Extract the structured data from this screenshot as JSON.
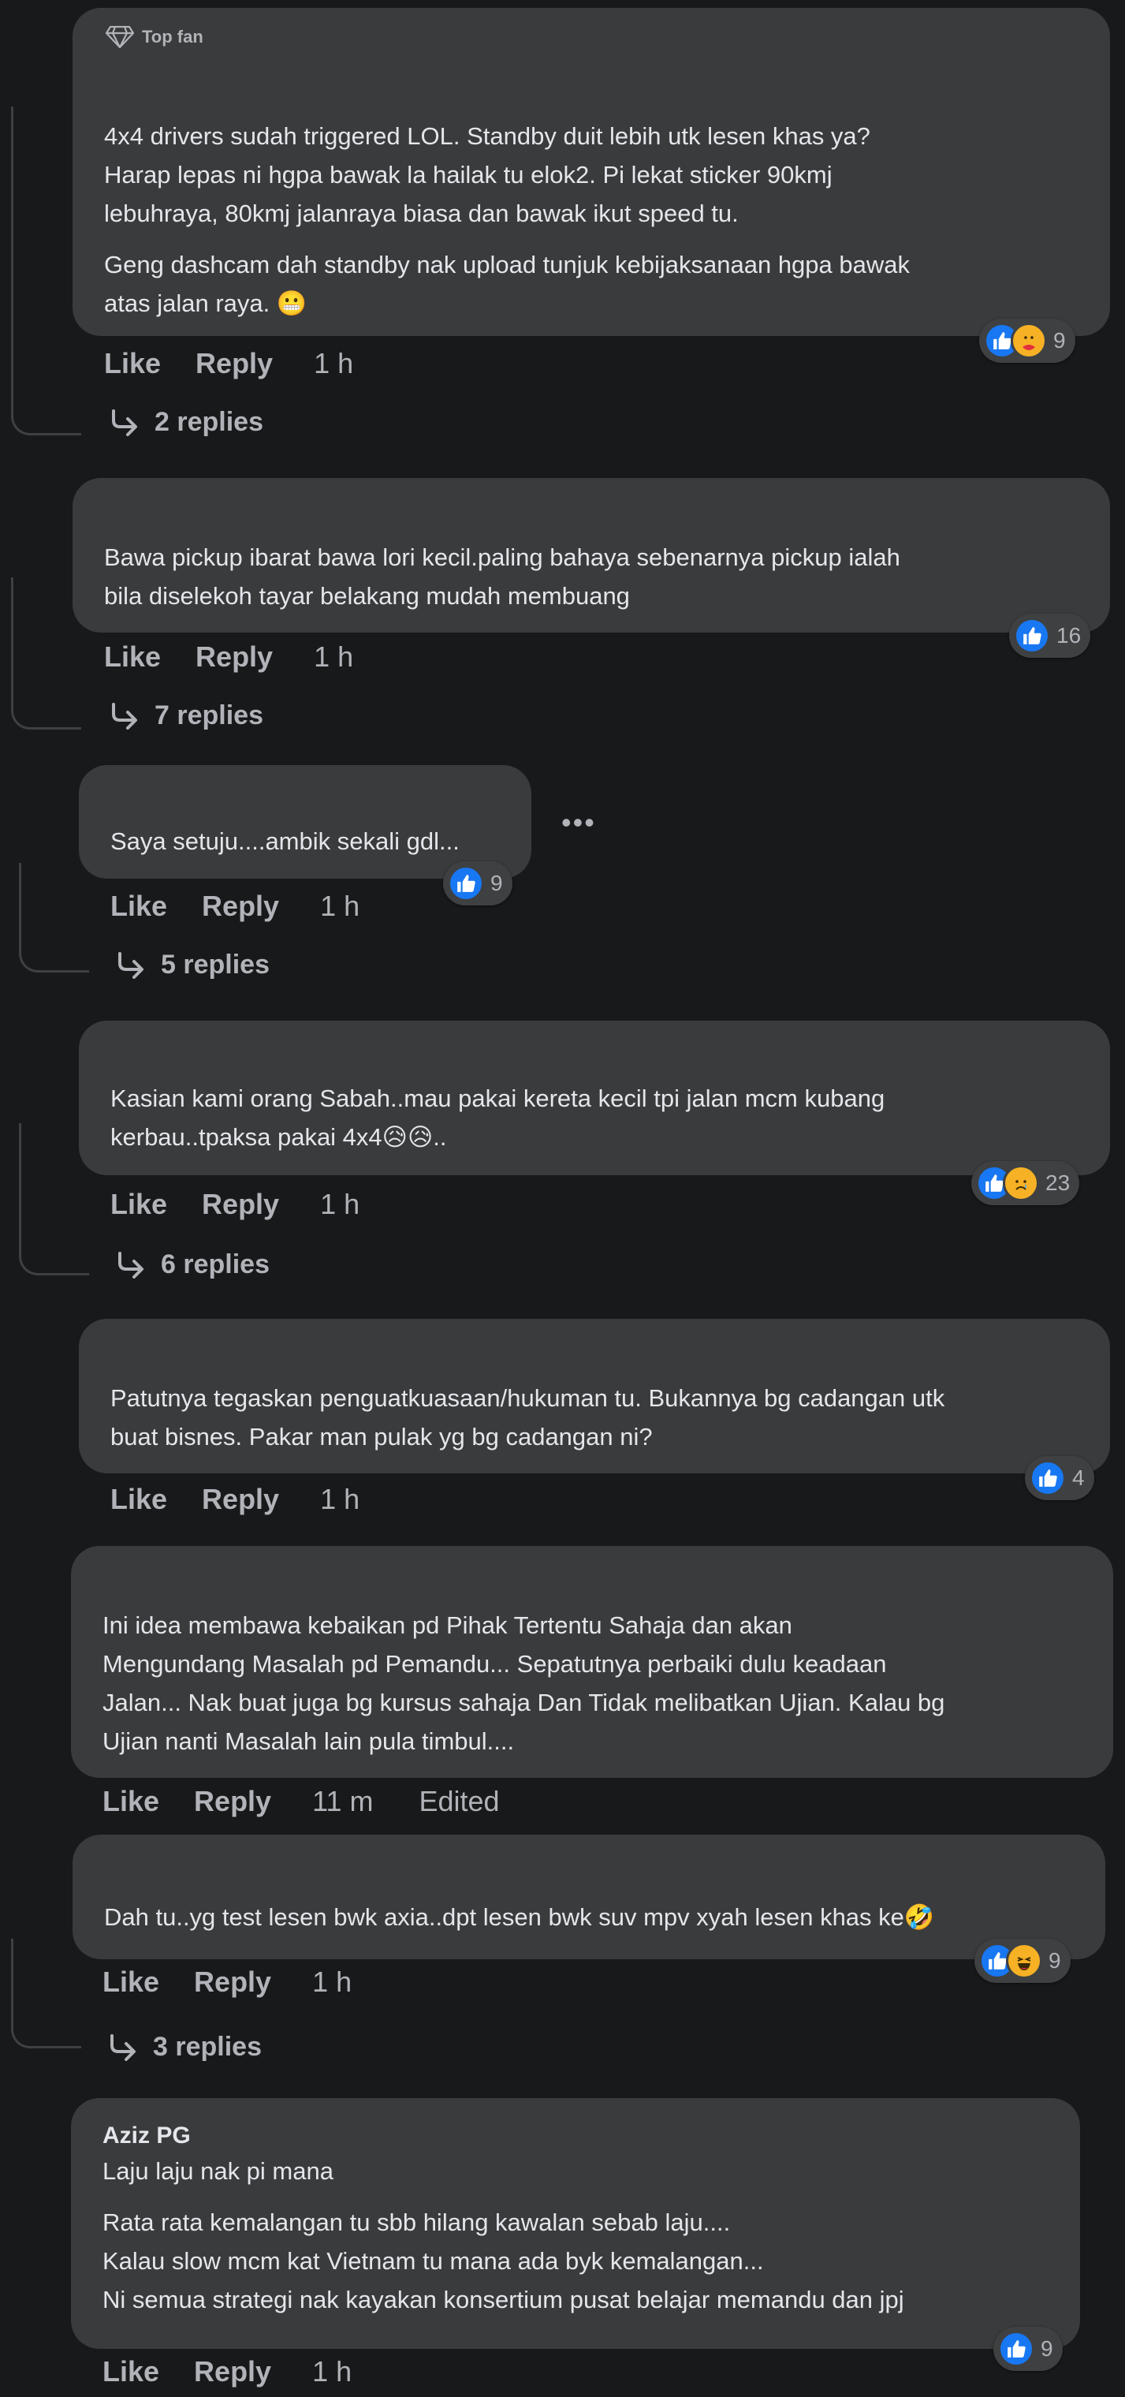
{
  "comments": [
    {
      "badge": "Top fan",
      "paragraphs": [
        "4x4 drivers sudah triggered LOL. Standby duit lebih utk lesen khas ya?\nHarap lepas ni hgpa bawak la hailak tu elok2. Pi lekat sticker 90kmj\nlebuhraya, 80kmj jalanraya biasa dan bawak ikut speed tu.",
        "Geng dashcam dah standby nak upload tunjuk kebijaksanaan hgpa bawak\natas jalan raya. 😬"
      ],
      "reaction_count": "9",
      "like": "Like",
      "reply": "Reply",
      "time": "1 h",
      "replies": "2 replies"
    },
    {
      "paragraphs": [
        "Bawa pickup ibarat bawa lori kecil.paling bahaya sebenarnya pickup ialah\nbila diselekoh tayar belakang mudah membuang"
      ],
      "reaction_count": "16",
      "like": "Like",
      "reply": "Reply",
      "time": "1 h",
      "replies": "7 replies"
    },
    {
      "paragraphs": [
        "Saya setuju....ambik sekali gdl..."
      ],
      "more": "•••",
      "reaction_count": "9",
      "like": "Like",
      "reply": "Reply",
      "time": "1 h",
      "replies": "5 replies"
    },
    {
      "paragraphs": [
        "Kasian kami orang Sabah..mau pakai kereta kecil tpi jalan mcm kubang\nkerbau..tpaksa pakai 4x4😥😥.."
      ],
      "reaction_count": "23",
      "like": "Like",
      "reply": "Reply",
      "time": "1 h",
      "replies": "6 replies"
    },
    {
      "paragraphs": [
        "Patutnya tegaskan penguatkuasaan/hukuman tu. Bukannya bg cadangan utk\nbuat bisnes. Pakar man pulak yg bg cadangan ni?"
      ],
      "reaction_count": "4",
      "like": "Like",
      "reply": "Reply",
      "time": "1 h"
    },
    {
      "paragraphs": [
        "Ini idea membawa kebaikan pd Pihak Tertentu Sahaja dan akan\nMengundang Masalah pd Pemandu... Sepatutnya perbaiki dulu keadaan\nJalan... Nak buat juga bg kursus sahaja Dan Tidak melibatkan Ujian. Kalau bg\nUjian nanti Masalah lain pula timbul...."
      ],
      "like": "Like",
      "reply": "Reply",
      "time": "11 m",
      "edited": "Edited"
    },
    {
      "paragraphs": [
        "Dah tu..yg test lesen bwk axia..dpt lesen bwk suv mpv xyah lesen khas ke🤣"
      ],
      "reaction_count": "9",
      "like": "Like",
      "reply": "Reply",
      "time": "1 h",
      "replies": "3 replies"
    },
    {
      "author": "Aziz PG",
      "paragraphs": [
        "Laju laju nak pi mana",
        "Rata rata kemalangan tu sbb hilang kawalan sebab laju....\nKalau slow mcm kat Vietnam tu mana ada byk kemalangan...\nNi semua strategi nak kayakan konsertium pusat belajar memandu dan jpj"
      ],
      "reaction_count": "9",
      "like": "Like",
      "reply": "Reply",
      "time": "1 h"
    }
  ],
  "icons": {
    "badge": "diamond-icon",
    "like": "thumbs-up-icon",
    "care": "care-hug-icon",
    "sad": "sad-face-icon",
    "laugh": "laughing-face-icon",
    "reply_arrow": "reply-arrow-icon"
  },
  "colors": {
    "background": "#18191a",
    "bubble": "#3a3b3c",
    "text": "#e4e6eb",
    "secondary": "#b0b3b8",
    "like_blue": "#1877f2"
  }
}
